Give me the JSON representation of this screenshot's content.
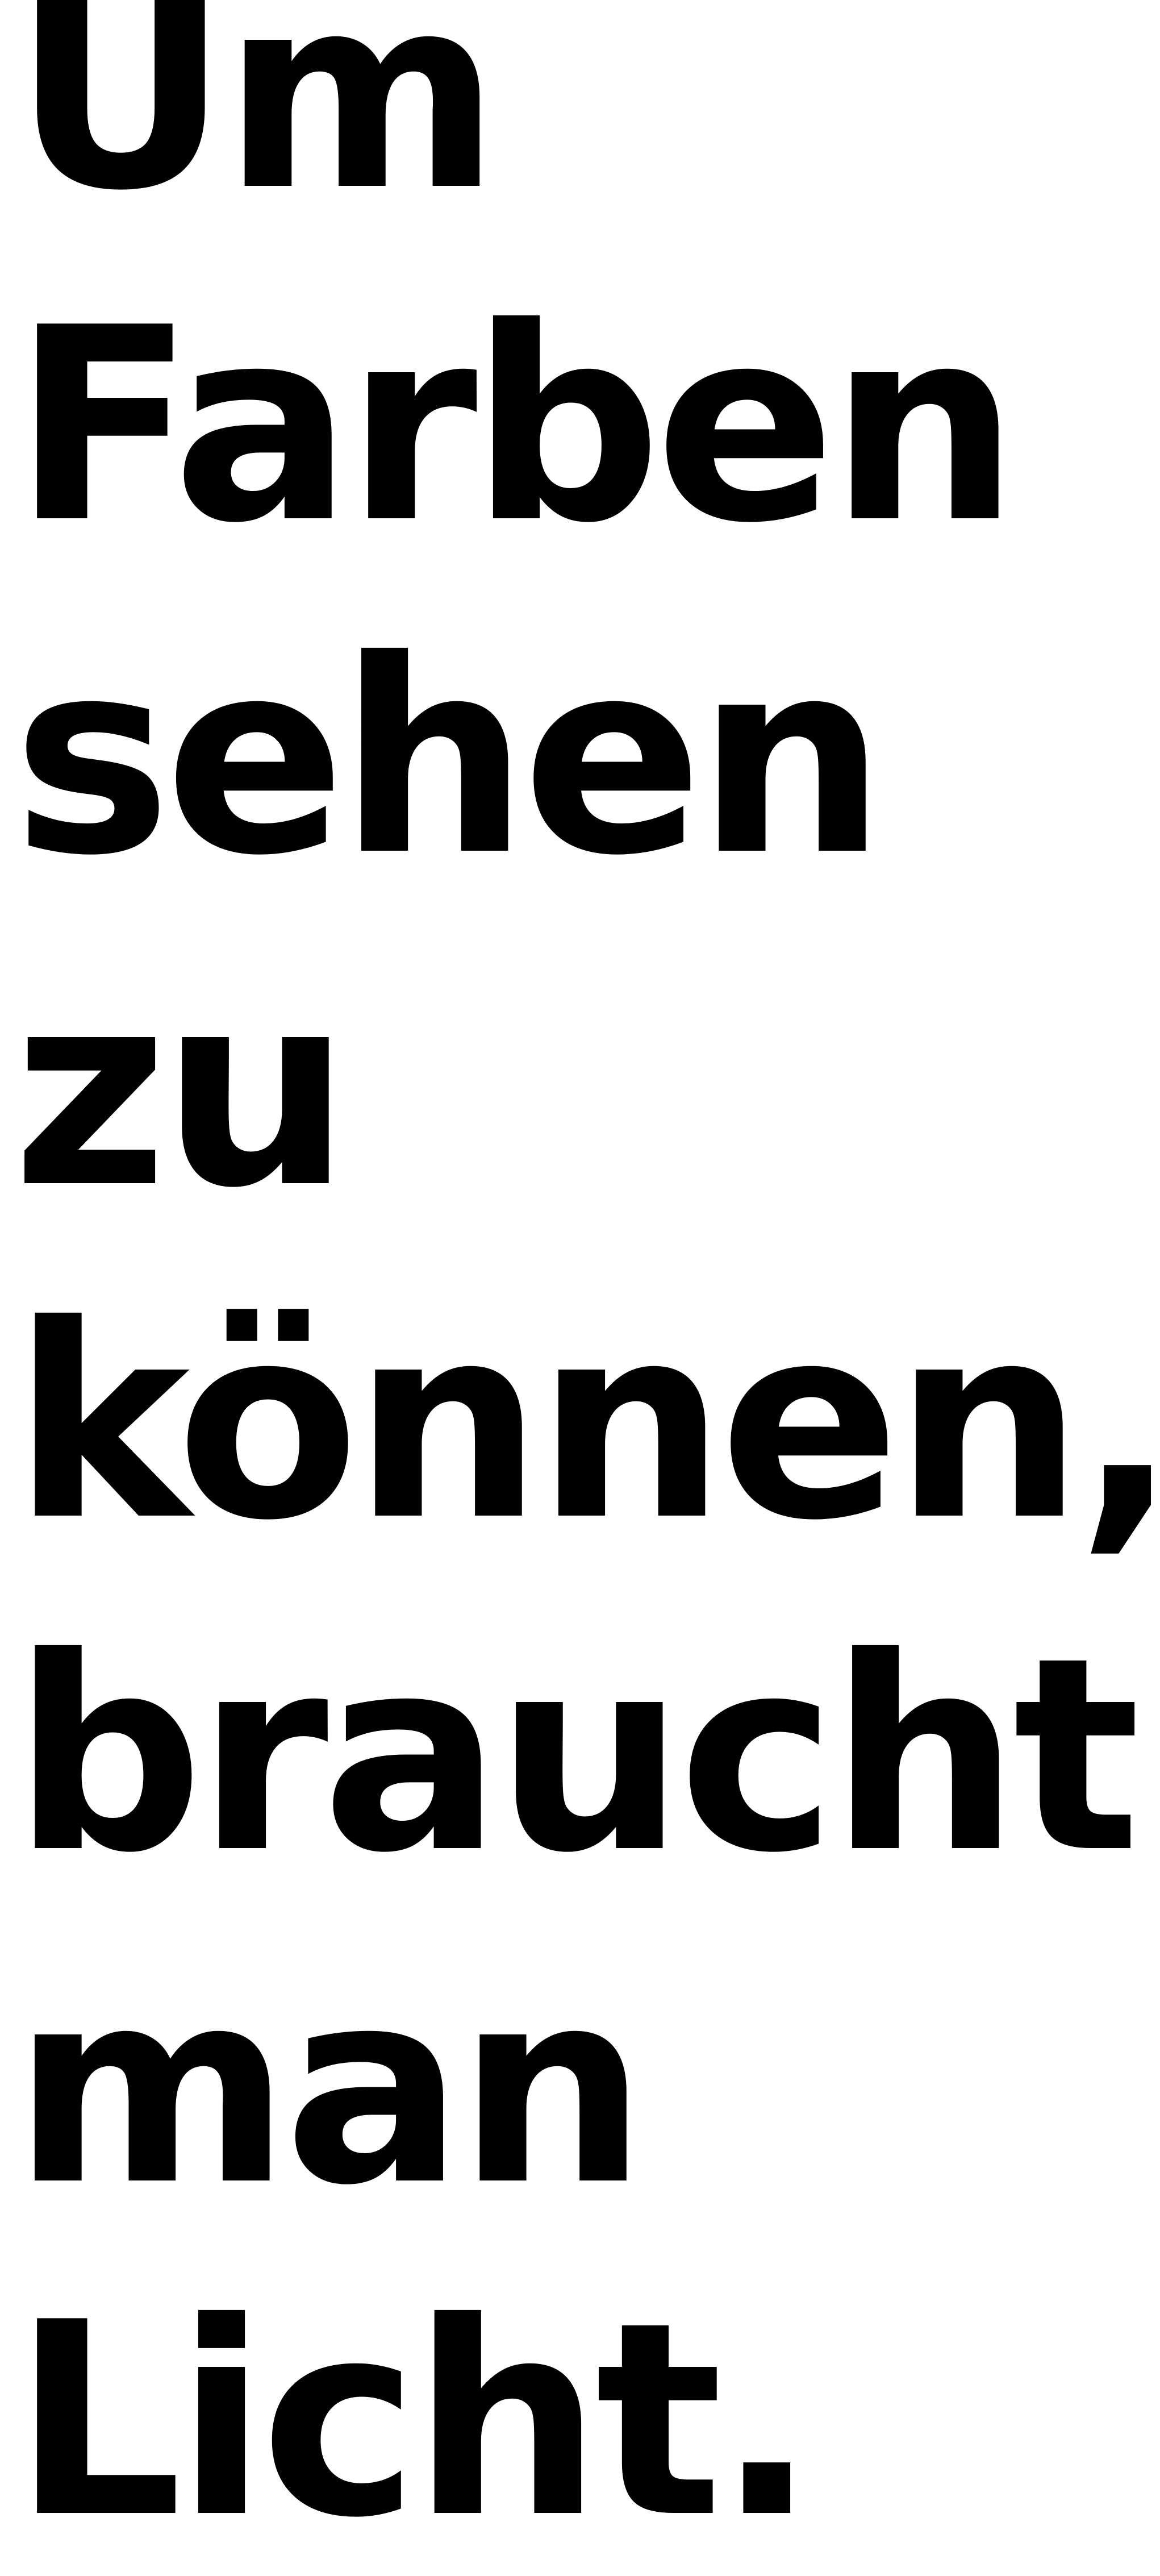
{
  "text_lines": [
    "Um",
    "Farben",
    "sehen",
    "zu",
    "können,",
    "braucht",
    "man",
    "Licht."
  ],
  "colors": {
    "background": "#ffffff",
    "text": "#000000"
  }
}
